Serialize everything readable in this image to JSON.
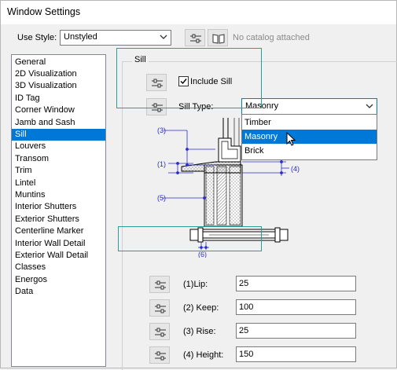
{
  "window": {
    "title": "Window Settings"
  },
  "toolbar": {
    "use_style_label": "Use Style:",
    "use_style_value": "Unstyled",
    "catalog_status": "No catalog attached"
  },
  "categories": {
    "items": [
      {
        "label": "General"
      },
      {
        "label": "2D Visualization"
      },
      {
        "label": "3D Visualization"
      },
      {
        "label": "ID Tag"
      },
      {
        "label": "Corner Window"
      },
      {
        "label": "Jamb and Sash"
      },
      {
        "label": "Sill",
        "selected": true
      },
      {
        "label": "Louvers"
      },
      {
        "label": "Transom"
      },
      {
        "label": "Trim"
      },
      {
        "label": "Lintel"
      },
      {
        "label": "Muntins"
      },
      {
        "label": "Interior Shutters"
      },
      {
        "label": "Exterior Shutters"
      },
      {
        "label": "Centerline Marker"
      },
      {
        "label": "Interior Wall Detail"
      },
      {
        "label": "Exterior Wall Detail"
      },
      {
        "label": "Classes"
      },
      {
        "label": "Energos"
      },
      {
        "label": "Data"
      }
    ]
  },
  "sill": {
    "group_title": "Sill",
    "include_label": "Include Sill",
    "include_checked": true,
    "type_label": "Sill Type:",
    "type_value": "Masonry",
    "type_options": [
      "Timber",
      "Masonry",
      "Brick"
    ],
    "highlighted_option": "Masonry",
    "diagram_labels": {
      "d1": "(1)",
      "d3": "(3)",
      "d4": "(4)",
      "d5": "(5)",
      "d6": "(6)"
    },
    "params": [
      {
        "label": "(1)Lip:",
        "value": "25"
      },
      {
        "label": "(2) Keep:",
        "value": "100"
      },
      {
        "label": "(3) Rise:",
        "value": "25"
      },
      {
        "label": "(4) Height:",
        "value": "150"
      }
    ]
  },
  "colors": {
    "accent": "#0078d7",
    "highlight_box": "#2a9d9d",
    "dimension": "#2c2cc8"
  }
}
